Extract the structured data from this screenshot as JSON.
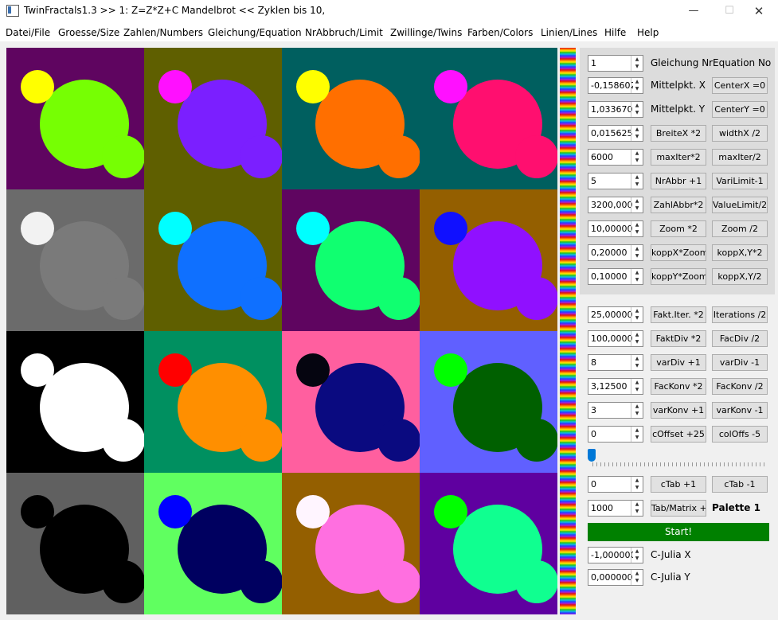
{
  "window": {
    "title": "TwinFractals1.3 >> 1: Z=Z*Z+C Mandelbrot << Zyklen bis 10,",
    "minimize": "—",
    "maximize": "☐",
    "close": "✕"
  },
  "menu": [
    "Datei/File",
    "Groesse/Size",
    "Zahlen/Numbers",
    "Gleichung/Equation",
    "NrAbbruch/Limit",
    "Zwillinge/Twins",
    "Farben/Colors",
    "Linien/Lines",
    "Hilfe",
    "Help"
  ],
  "tiles": [
    {
      "bg": "#5f0560",
      "big": "#76ff03",
      "small": "#ffff00"
    },
    {
      "bg": "#5f5f00",
      "big": "#7b1fff",
      "small": "#ff10ff"
    },
    {
      "bg": "#005f5f",
      "big": "#ff6f00",
      "small": "#ffff00"
    },
    {
      "bg": "#005f5f",
      "big": "#ff0f6f",
      "small": "#ff10ff"
    },
    {
      "bg": "#6b6b6b",
      "big": "#7a7a7a",
      "small": "#f2f2f2"
    },
    {
      "bg": "#5f5f00",
      "big": "#0f70ff",
      "small": "#00ffff"
    },
    {
      "bg": "#5f0560",
      "big": "#10ff70",
      "small": "#00ffff"
    },
    {
      "bg": "#945f00",
      "big": "#9010ff",
      "small": "#1010ff"
    },
    {
      "bg": "#000000",
      "big": "#ffffff",
      "small": "#ffffff"
    },
    {
      "bg": "#009060",
      "big": "#ff8f00",
      "small": "#ff0000"
    },
    {
      "bg": "#ff5f9f",
      "big": "#0a0a80",
      "small": "#050510"
    },
    {
      "bg": "#6060ff",
      "big": "#006000",
      "small": "#00ff00"
    },
    {
      "bg": "#606060",
      "big": "#000000",
      "small": "#000000"
    },
    {
      "bg": "#60ff60",
      "big": "#000060",
      "small": "#0000ff"
    },
    {
      "bg": "#945f00",
      "big": "#ff6fe0",
      "small": "#fff5ff"
    },
    {
      "bg": "#5f00a0",
      "big": "#10ff90",
      "small": "#00ff00"
    }
  ],
  "panel": {
    "equation": {
      "value": "1",
      "label": "Gleichung Nr",
      "label2": "Equation No"
    },
    "center_x": {
      "value": "-0,158602",
      "label": "Mittelpkt. X",
      "button": "CenterX =0"
    },
    "center_y": {
      "value": "1,0336700",
      "label": "Mittelpkt. Y",
      "button": "CenterY =0"
    },
    "width": {
      "value": "0,0156250",
      "button1": "BreiteX *2",
      "button2": "widthX /2"
    },
    "maxiter": {
      "value": "6000",
      "button1": "maxIter*2",
      "button2": "maxIter/2"
    },
    "nrabbr": {
      "value": "5",
      "button1": "NrAbbr +1",
      "button2": "VariLimit-1"
    },
    "zahlabbr": {
      "value": "3200,0000",
      "button1": "ZahlAbbr*2",
      "button2": "ValueLimit/2"
    },
    "zoom": {
      "value": "10,000000",
      "button1": "Zoom *2",
      "button2": "Zoom /2"
    },
    "koppx": {
      "value": "0,20000",
      "button1": "koppX*Zoom",
      "button2": "koppX,Y*2"
    },
    "koppy": {
      "value": "0,10000",
      "button1": "koppY*Zoom",
      "button2": "koppX,Y/2"
    },
    "fakt_iter": {
      "value": "25,00000",
      "button1": "Fakt.Iter. *2",
      "button2": "Iterations /2"
    },
    "fakt_div": {
      "value": "100,00000",
      "button1": "FaktDiv *2",
      "button2": "FacDiv /2"
    },
    "var_div": {
      "value": "8",
      "button1": "varDiv +1",
      "button2": "varDiv -1"
    },
    "fac_konv": {
      "value": "3,12500",
      "button1": "FacKonv *2",
      "button2": "FacKonv /2"
    },
    "var_konv": {
      "value": "3",
      "button1": "varKonv +1",
      "button2": "varKonv -1"
    },
    "c_offset": {
      "value": "0",
      "button1": "cOffset +25",
      "button2": "colOffs -5"
    },
    "slider_level": 0,
    "ctab": {
      "value": "0",
      "button1": "cTab +1",
      "button2": "cTab -1"
    },
    "tab_matrix": {
      "value": "1000",
      "button": "Tab/Matrix +",
      "label": "Palette 1"
    },
    "start": "Start!",
    "julia_x": {
      "value": "-1,000000",
      "label": "C-Julia X"
    },
    "julia_y": {
      "value": "0,0000000",
      "label": "C-Julia Y"
    }
  }
}
